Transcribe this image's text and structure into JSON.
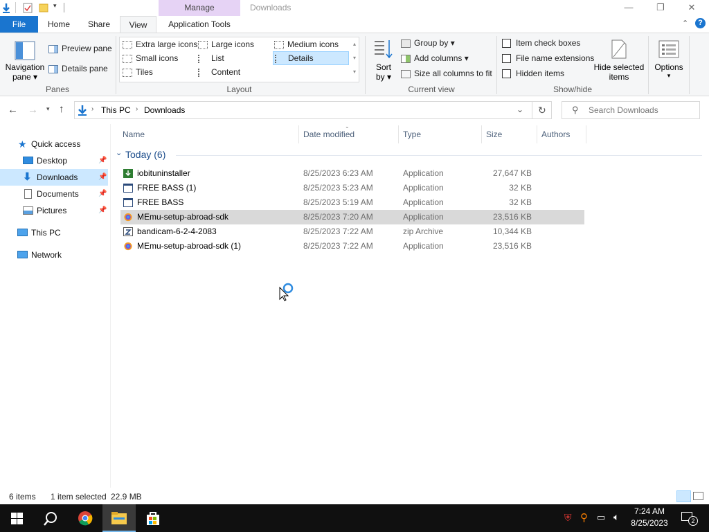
{
  "titlebar": {
    "manage_label": "Manage",
    "title": "Downloads"
  },
  "tabs": {
    "file": "File",
    "home": "Home",
    "share": "Share",
    "view": "View",
    "app_tools": "Application Tools"
  },
  "ribbon": {
    "panes": {
      "nav_pane": "Navigation",
      "nav_pane2": "pane",
      "preview_pane": "Preview pane",
      "details_pane": "Details pane",
      "label": "Panes"
    },
    "layout": {
      "extra_large": "Extra large icons",
      "large": "Large icons",
      "medium": "Medium icons",
      "small": "Small icons",
      "list": "List",
      "details": "Details",
      "tiles": "Tiles",
      "content": "Content",
      "label": "Layout"
    },
    "current_view": {
      "sort": "Sort",
      "sort2": "by",
      "group_by": "Group by",
      "add_columns": "Add columns",
      "size_all": "Size all columns to fit",
      "label": "Current view"
    },
    "show_hide": {
      "item_check": "Item check boxes",
      "file_ext": "File name extensions",
      "hidden": "Hidden items",
      "hide_selected": "Hide selected",
      "hide_selected2": "items",
      "label": "Show/hide"
    },
    "options": "Options"
  },
  "address": {
    "this_pc": "This PC",
    "downloads": "Downloads",
    "search_placeholder": "Search Downloads"
  },
  "nav": {
    "quick_access": "Quick access",
    "desktop": "Desktop",
    "downloads": "Downloads",
    "documents": "Documents",
    "pictures": "Pictures",
    "this_pc": "This PC",
    "network": "Network"
  },
  "columns": {
    "name": "Name",
    "date": "Date modified",
    "type": "Type",
    "size": "Size",
    "authors": "Authors"
  },
  "group": {
    "label": "Today (6)"
  },
  "files": [
    {
      "name": "iobituninstaller",
      "date": "8/25/2023 6:23 AM",
      "type": "Application",
      "size": "27,647 KB"
    },
    {
      "name": "FREE BASS (1)",
      "date": "8/25/2023 5:23 AM",
      "type": "Application",
      "size": "32 KB"
    },
    {
      "name": "FREE BASS",
      "date": "8/25/2023 5:19 AM",
      "type": "Application",
      "size": "32 KB"
    },
    {
      "name": "MEmu-setup-abroad-sdk",
      "date": "8/25/2023 7:20 AM",
      "type": "Application",
      "size": "23,516 KB"
    },
    {
      "name": "bandicam-6-2-4-2083",
      "date": "8/25/2023 7:22 AM",
      "type": "zip Archive",
      "size": "10,344 KB"
    },
    {
      "name": "MEmu-setup-abroad-sdk (1)",
      "date": "8/25/2023 7:22 AM",
      "type": "Application",
      "size": "23,516 KB"
    }
  ],
  "status": {
    "items": "6 items",
    "selected": "1 item selected",
    "size": "22.9 MB"
  },
  "taskbar": {
    "time": "7:24 AM",
    "date": "8/25/2023",
    "notif_count": "2"
  },
  "colors": {
    "accent": "#1a75cf",
    "selection": "#cce8ff",
    "row_selected": "#d9d9d9",
    "manage_band": "#e6d3f5"
  }
}
